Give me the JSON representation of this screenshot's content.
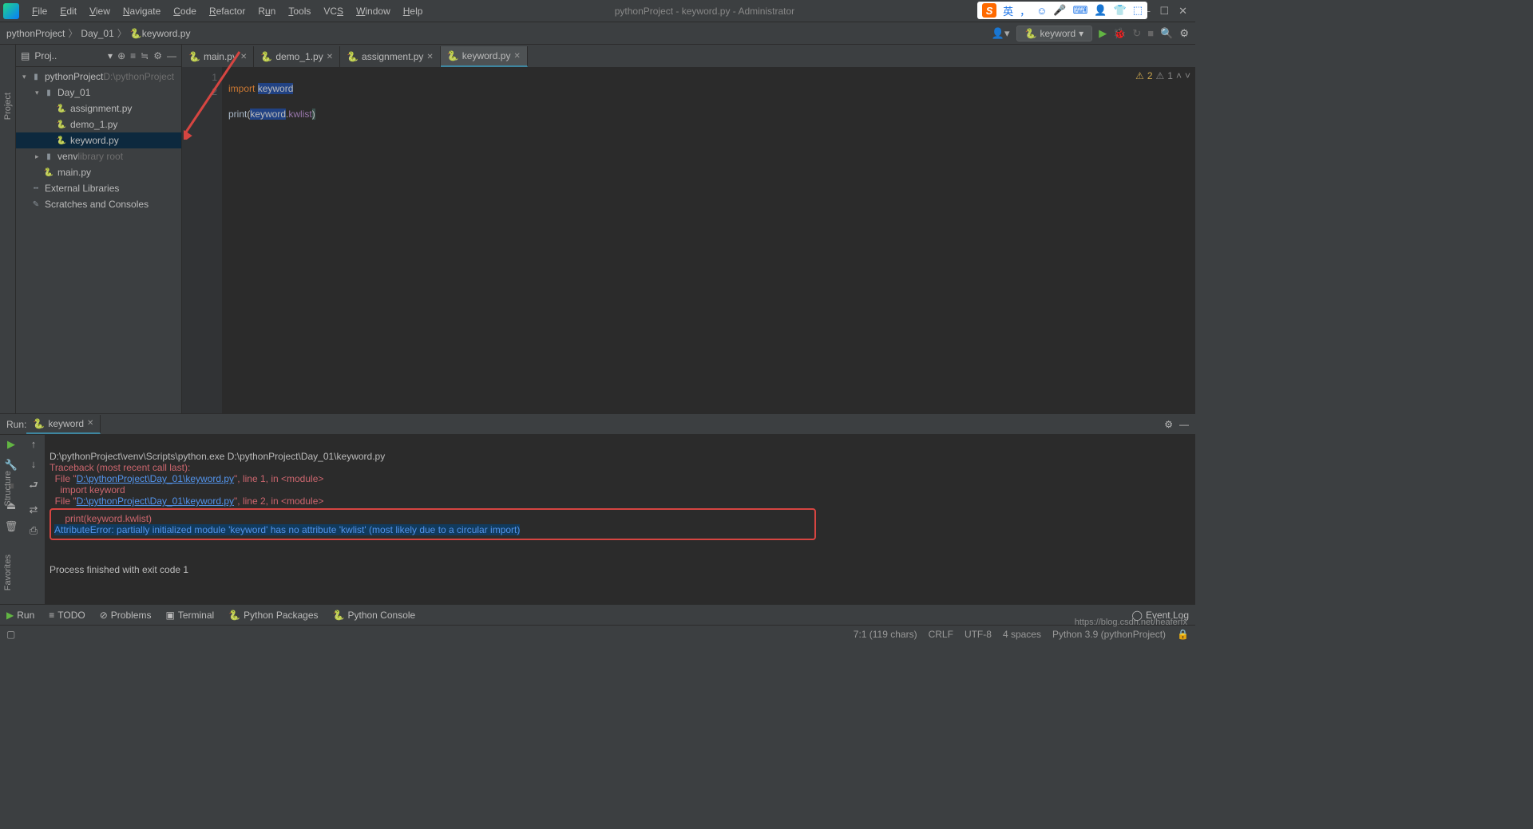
{
  "window": {
    "title": "pythonProject - keyword.py - Administrator",
    "menu": [
      "File",
      "Edit",
      "View",
      "Navigate",
      "Code",
      "Refactor",
      "Run",
      "Tools",
      "VCS",
      "Window",
      "Help"
    ]
  },
  "breadcrumbs": [
    "pythonProject",
    "Day_01",
    "keyword.py"
  ],
  "run_config": {
    "name": "keyword"
  },
  "sidebar": {
    "title": "Proj..",
    "items": [
      {
        "type": "project",
        "label": "pythonProject",
        "hint": "D:\\pythonProject",
        "depth": 0,
        "expanded": true,
        "kind": "folder"
      },
      {
        "type": "folder",
        "label": "Day_01",
        "depth": 1,
        "expanded": true,
        "kind": "folder"
      },
      {
        "type": "file",
        "label": "assignment.py",
        "depth": 2,
        "kind": "py"
      },
      {
        "type": "file",
        "label": "demo_1.py",
        "depth": 2,
        "kind": "py"
      },
      {
        "type": "file",
        "label": "keyword.py",
        "depth": 2,
        "kind": "py",
        "selected": true
      },
      {
        "type": "folder",
        "label": "venv",
        "hint": "library root",
        "depth": 1,
        "expanded": false,
        "kind": "folder"
      },
      {
        "type": "file",
        "label": "main.py",
        "depth": 1,
        "kind": "py"
      },
      {
        "type": "lib",
        "label": "External Libraries",
        "depth": 0,
        "kind": "lib"
      },
      {
        "type": "scratch",
        "label": "Scratches and Consoles",
        "depth": 0,
        "kind": "scratch"
      }
    ]
  },
  "tabs": [
    {
      "label": "main.py",
      "active": false
    },
    {
      "label": "demo_1.py",
      "active": false
    },
    {
      "label": "assignment.py",
      "active": false
    },
    {
      "label": "keyword.py",
      "active": true
    }
  ],
  "code": {
    "lines": [
      "1",
      "2"
    ],
    "line1": {
      "kw": "import",
      "rest": " ",
      "hl": "keyword"
    },
    "line2": {
      "a": "print",
      "b": "(",
      "c": "keyword",
      "d": ".",
      "e": "kwlist",
      "f": ")"
    }
  },
  "editor_badges": {
    "warn_count": "2",
    "gray_count": "1"
  },
  "run_panel": {
    "label": "Run:",
    "tab": "keyword"
  },
  "console": {
    "cmd": "D:\\pythonProject\\venv\\Scripts\\python.exe D:\\pythonProject\\Day_01\\keyword.py",
    "trace_header": "Traceback (most recent call last):",
    "f1_a": "  File \"",
    "f1_link": "D:\\pythonProject\\Day_01\\keyword.py",
    "f1_b": "\", line 1, in <module>",
    "l1": "    import keyword",
    "f2_a": "  File \"",
    "f2_link": "D:\\pythonProject\\Day_01\\keyword.py",
    "f2_b": "\", line 2, in <module>",
    "l2": "    print(keyword.kwlist)",
    "error": "AttributeError: partially initialized module 'keyword' has no attribute 'kwlist' (most likely due to a circular import)",
    "finished": "Process finished with exit code 1"
  },
  "bottom_bar": {
    "items": [
      "Run",
      "TODO",
      "Problems",
      "Terminal",
      "Python Packages",
      "Python Console"
    ],
    "event_log": "Event Log"
  },
  "status": {
    "left": "",
    "caret": "7:1 (119 chars)",
    "crlf": "CRLF",
    "enc": "UTF-8",
    "indent": "4 spaces",
    "python": "Python 3.9 (pythonProject)",
    "lock": "🔒"
  },
  "watermark": "https://blog.csdn.net/heaferfx",
  "ime": {
    "letters": [
      "英",
      "，",
      "☺",
      "🎤",
      "⌨",
      "👤",
      "👕",
      "⬚"
    ]
  }
}
